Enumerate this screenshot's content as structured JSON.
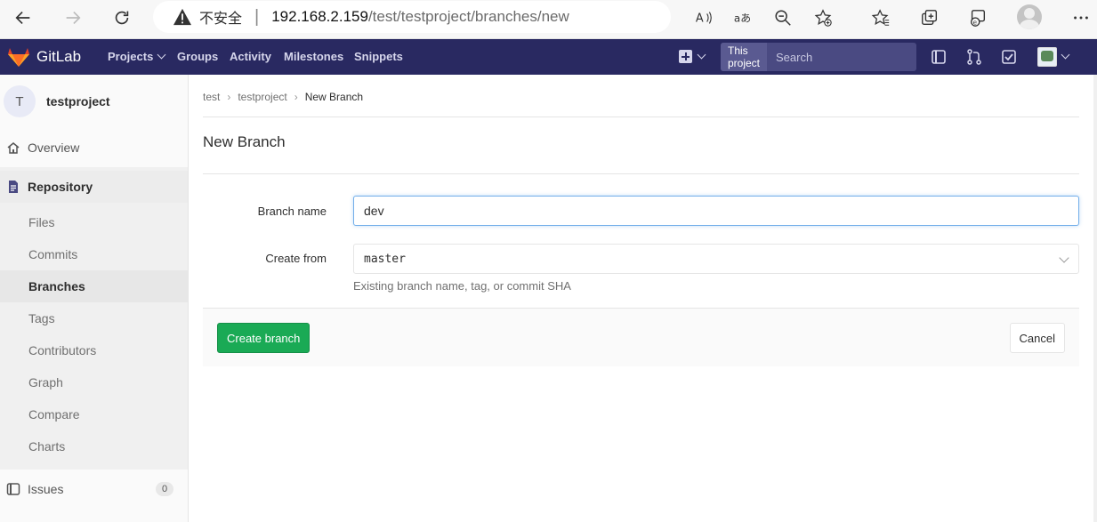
{
  "browser": {
    "insecure_label": "不安全",
    "url_host": "192.168.2.159",
    "url_path": "/test/testproject/branches/new"
  },
  "navbar": {
    "brand": "GitLab",
    "links": [
      "Projects",
      "Groups",
      "Activity",
      "Milestones",
      "Snippets"
    ],
    "search_scope": "This project",
    "search_placeholder": "Search"
  },
  "sidebar": {
    "project_initial": "T",
    "project_name": "testproject",
    "overview": "Overview",
    "repository": "Repository",
    "repo_items": [
      "Files",
      "Commits",
      "Branches",
      "Tags",
      "Contributors",
      "Graph",
      "Compare",
      "Charts"
    ],
    "issues": "Issues",
    "issues_count": "0"
  },
  "breadcrumb": [
    "test",
    "testproject",
    "New Branch"
  ],
  "page": {
    "title": "New Branch",
    "branch_name_label": "Branch name",
    "branch_name_value": "dev",
    "create_from_label": "Create from",
    "create_from_value": "master",
    "help": "Existing branch name, tag, or commit SHA",
    "create_button": "Create branch",
    "cancel_button": "Cancel"
  },
  "colors": {
    "navbar": "#292961",
    "primary_button": "#1aaa55",
    "focus_border": "#73afea"
  }
}
